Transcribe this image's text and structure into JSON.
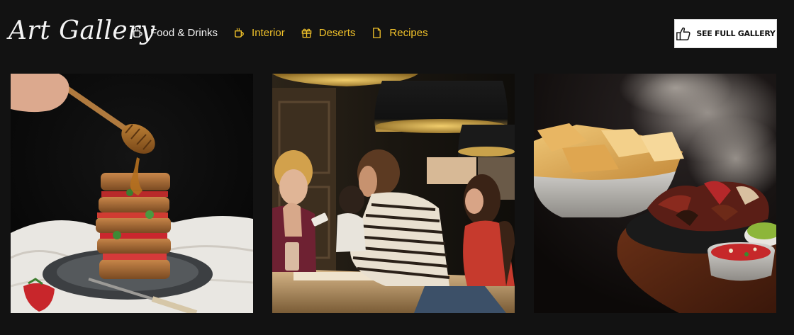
{
  "header": {
    "brand": "Art Gallery"
  },
  "filters": [
    {
      "label": "Food & Drinks",
      "icon": "coffee-cup-icon",
      "active": true
    },
    {
      "label": "Interior",
      "icon": "mug-icon",
      "active": false
    },
    {
      "label": "Deserts",
      "icon": "gift-icon",
      "active": false
    },
    {
      "label": "Recipes",
      "icon": "document-icon",
      "active": false
    }
  ],
  "cta": {
    "label": "SEE FULL GALLERY",
    "icon": "thumbs-up-icon"
  },
  "gallery": [
    {
      "subject": "honey-drizzled-french-toast-stack"
    },
    {
      "subject": "people-in-cafe-under-pendant-lamps"
    },
    {
      "subject": "steaming-fajita-platter-with-chips"
    }
  ],
  "colors": {
    "background": "#121212",
    "accent": "#f0c12a",
    "active_text": "#f2f2f2",
    "button_bg": "#ffffff"
  }
}
